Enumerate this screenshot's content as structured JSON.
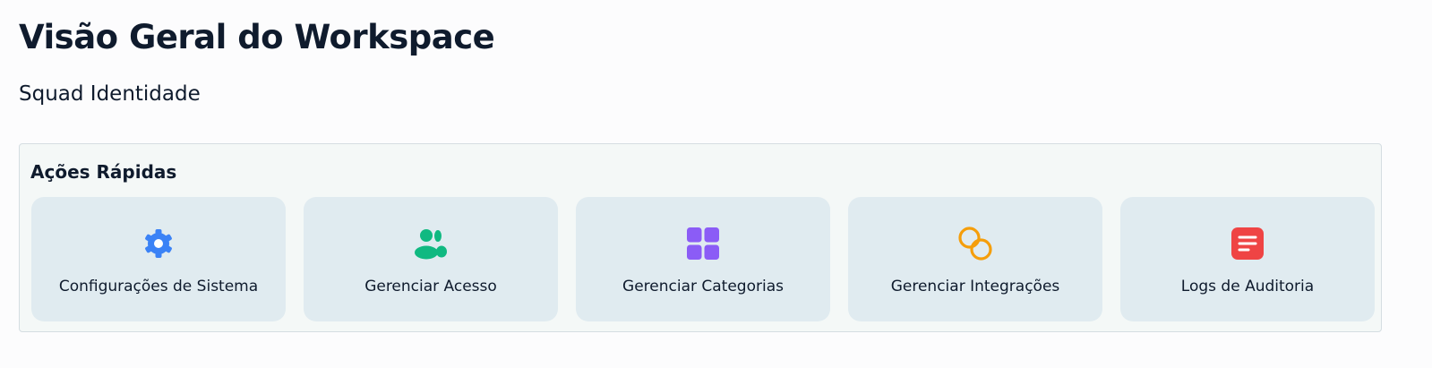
{
  "header": {
    "title": "Visão Geral do Workspace",
    "subtitle": "Squad Identidade"
  },
  "quick_actions": {
    "heading": "Ações Rápidas",
    "items": [
      {
        "label": "Configurações de Sistema",
        "icon": "gear-icon",
        "color": "#3b82f6"
      },
      {
        "label": "Gerenciar Acesso",
        "icon": "users-icon",
        "color": "#10b981"
      },
      {
        "label": "Gerenciar Categorias",
        "icon": "grid-icon",
        "color": "#8b5cf6"
      },
      {
        "label": "Gerenciar Integrações",
        "icon": "link-icon",
        "color": "#f59e0b"
      },
      {
        "label": "Logs de Auditoria",
        "icon": "document-icon",
        "color": "#ef4444"
      }
    ]
  }
}
